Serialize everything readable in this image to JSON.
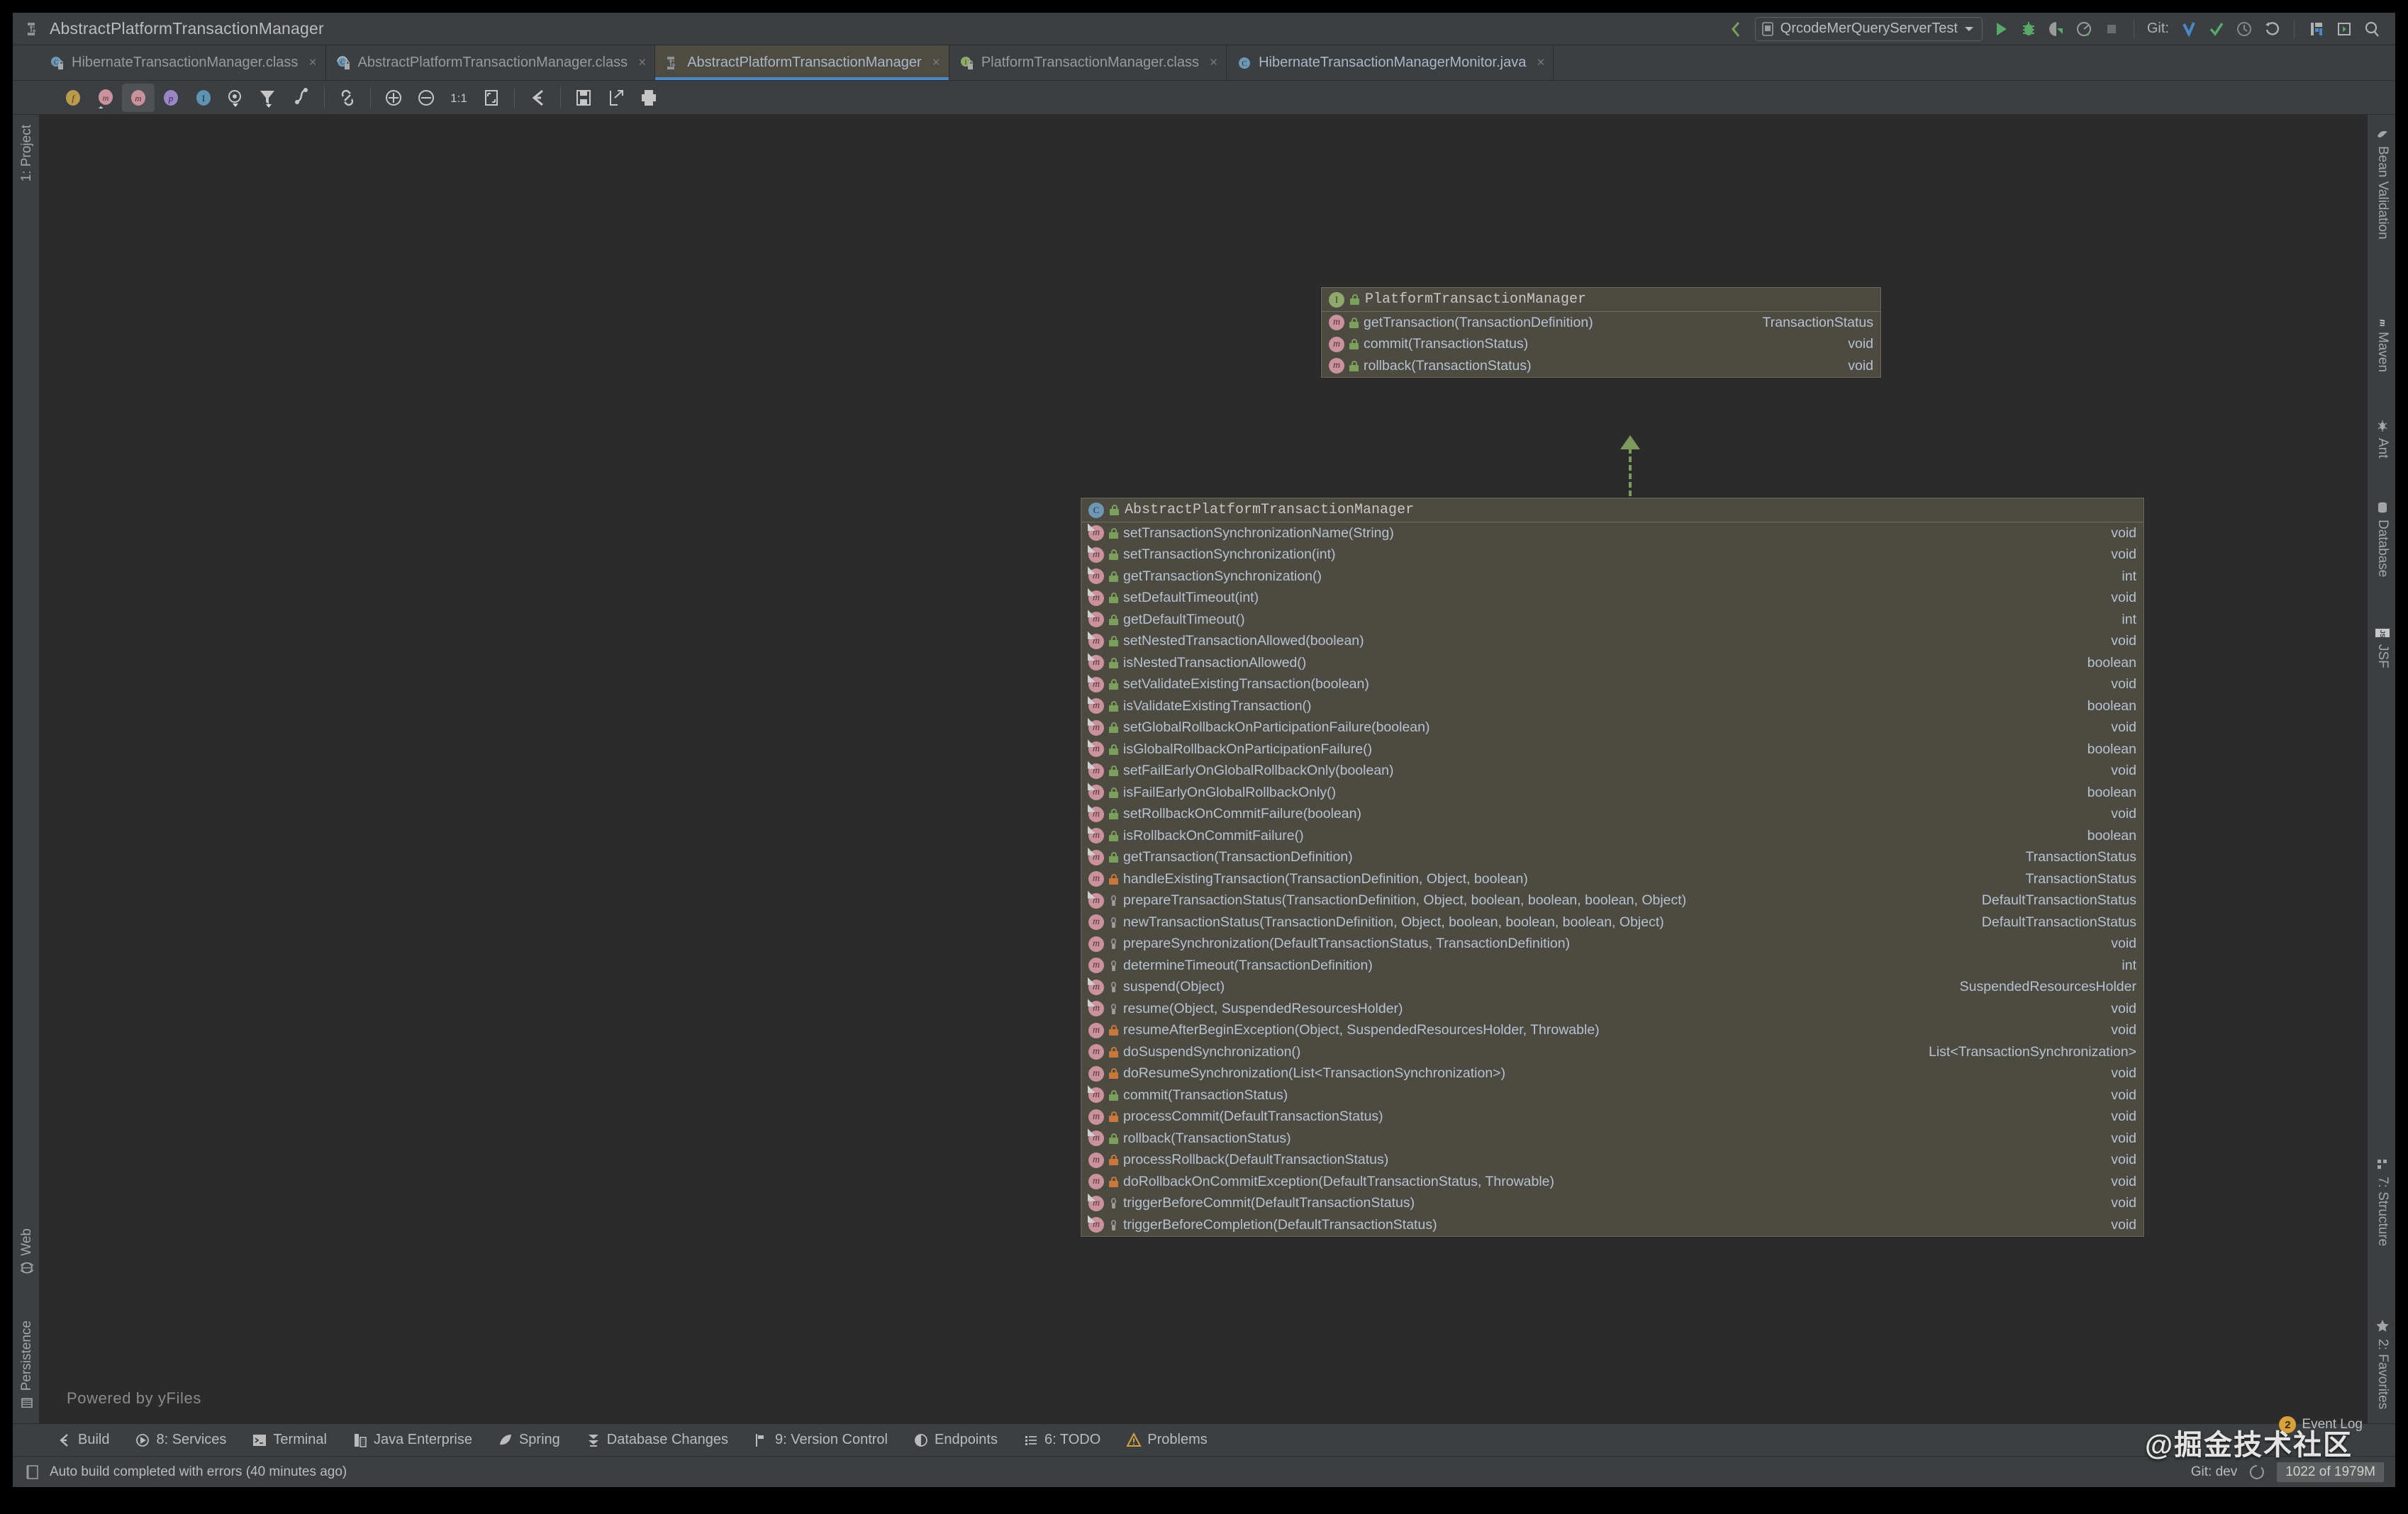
{
  "window": {
    "title": "AbstractPlatformTransactionManager",
    "title_icon": "uml-diagram-icon"
  },
  "toolbar_right": {
    "run_config": "QrcodeMerQueryServerTest",
    "git_label": "Git:",
    "icons": [
      "back-arrow-icon",
      "run-icon",
      "debug-icon",
      "run-coverage-icon",
      "profile-icon",
      "stop-icon",
      "git-update-icon",
      "git-commit-icon",
      "git-history-icon",
      "git-rollback-icon",
      "structure-icon",
      "preview-icon",
      "search-everywhere-icon"
    ]
  },
  "tabs": [
    {
      "label": "HibernateTransactionManager.class",
      "icon": "class-locked-icon",
      "active": false,
      "close": "×"
    },
    {
      "label": "AbstractPlatformTransactionManager.class",
      "icon": "abstract-class-locked-icon",
      "active": false,
      "close": "×"
    },
    {
      "label": "AbstractPlatformTransactionManager",
      "icon": "uml-diagram-icon",
      "active": true,
      "close": "×"
    },
    {
      "label": "PlatformTransactionManager.class",
      "icon": "interface-locked-icon",
      "active": false,
      "close": "×"
    },
    {
      "label": "HibernateTransactionManagerMonitor.java",
      "icon": "java-class-icon",
      "active": false,
      "close": "×"
    }
  ],
  "diagram_toolbar": [
    {
      "name": "show-fields-toggle",
      "glyph": "f"
    },
    {
      "name": "show-constructors-toggle",
      "glyph": "m"
    },
    {
      "name": "show-methods-toggle",
      "glyph": "m",
      "selected": true
    },
    {
      "name": "show-properties-toggle",
      "glyph": "p"
    },
    {
      "name": "show-inner-classes-toggle",
      "glyph": "I"
    },
    {
      "name": "visibility-level-dropdown",
      "glyph": "O"
    },
    {
      "name": "filter-dropdown",
      "glyph": "filter"
    },
    {
      "name": "show-dependencies-icon",
      "glyph": "dep"
    },
    {
      "name": "show-edges-icon",
      "glyph": "link"
    },
    {
      "name": "zoom-in-icon",
      "glyph": "plus"
    },
    {
      "name": "zoom-out-icon",
      "glyph": "minus"
    },
    {
      "name": "actual-size-icon",
      "glyph": "1:1"
    },
    {
      "name": "fit-content-icon",
      "glyph": "fit"
    },
    {
      "name": "layout-icon",
      "glyph": "layout"
    },
    {
      "name": "save-icon",
      "glyph": "save"
    },
    {
      "name": "export-icon",
      "glyph": "export"
    },
    {
      "name": "print-icon",
      "glyph": "print"
    }
  ],
  "canvas": {
    "powered_by": "Powered by yFiles"
  },
  "left_stripe": {
    "top": [
      "1: Project"
    ],
    "bottom": [
      "Web",
      "Persistence"
    ]
  },
  "right_stripe": {
    "top": [
      "Bean Validation",
      "Maven",
      "Ant",
      "Database",
      "JSF"
    ],
    "bottom": [
      "7: Structure",
      "2: Favorites"
    ]
  },
  "diagram": {
    "interface_box": {
      "name": "PlatformTransactionManager",
      "kind": "interface",
      "icon": "interface-icon",
      "members": [
        {
          "sig": "getTransaction(TransactionDefinition)",
          "ret": "TransactionStatus",
          "vis": "public",
          "overridden": false
        },
        {
          "sig": "commit(TransactionStatus)",
          "ret": "void",
          "vis": "public",
          "overridden": false
        },
        {
          "sig": "rollback(TransactionStatus)",
          "ret": "void",
          "vis": "public",
          "overridden": false
        }
      ]
    },
    "class_box": {
      "name": "AbstractPlatformTransactionManager",
      "kind": "abstract-class",
      "icon": "abstract-class-icon",
      "members": [
        {
          "sig": "setTransactionSynchronizationName(String)",
          "ret": "void",
          "vis": "public",
          "overridden": true
        },
        {
          "sig": "setTransactionSynchronization(int)",
          "ret": "void",
          "vis": "public",
          "overridden": true
        },
        {
          "sig": "getTransactionSynchronization()",
          "ret": "int",
          "vis": "public",
          "overridden": true
        },
        {
          "sig": "setDefaultTimeout(int)",
          "ret": "void",
          "vis": "public",
          "overridden": true
        },
        {
          "sig": "getDefaultTimeout()",
          "ret": "int",
          "vis": "public",
          "overridden": true
        },
        {
          "sig": "setNestedTransactionAllowed(boolean)",
          "ret": "void",
          "vis": "public",
          "overridden": true
        },
        {
          "sig": "isNestedTransactionAllowed()",
          "ret": "boolean",
          "vis": "public",
          "overridden": true
        },
        {
          "sig": "setValidateExistingTransaction(boolean)",
          "ret": "void",
          "vis": "public",
          "overridden": true
        },
        {
          "sig": "isValidateExistingTransaction()",
          "ret": "boolean",
          "vis": "public",
          "overridden": true
        },
        {
          "sig": "setGlobalRollbackOnParticipationFailure(boolean)",
          "ret": "void",
          "vis": "public",
          "overridden": true
        },
        {
          "sig": "isGlobalRollbackOnParticipationFailure()",
          "ret": "boolean",
          "vis": "public",
          "overridden": true
        },
        {
          "sig": "setFailEarlyOnGlobalRollbackOnly(boolean)",
          "ret": "void",
          "vis": "public",
          "overridden": true
        },
        {
          "sig": "isFailEarlyOnGlobalRollbackOnly()",
          "ret": "boolean",
          "vis": "public",
          "overridden": true
        },
        {
          "sig": "setRollbackOnCommitFailure(boolean)",
          "ret": "void",
          "vis": "public",
          "overridden": true
        },
        {
          "sig": "isRollbackOnCommitFailure()",
          "ret": "boolean",
          "vis": "public",
          "overridden": true
        },
        {
          "sig": "getTransaction(TransactionDefinition)",
          "ret": "TransactionStatus",
          "vis": "public",
          "overridden": true
        },
        {
          "sig": "handleExistingTransaction(TransactionDefinition, Object, boolean)",
          "ret": "TransactionStatus",
          "vis": "protected",
          "overridden": false
        },
        {
          "sig": "prepareTransactionStatus(TransactionDefinition, Object, boolean, boolean, boolean, Object)",
          "ret": "DefaultTransactionStatus",
          "vis": "package",
          "overridden": true
        },
        {
          "sig": "newTransactionStatus(TransactionDefinition, Object, boolean, boolean, boolean, Object)",
          "ret": "DefaultTransactionStatus",
          "vis": "package",
          "overridden": false
        },
        {
          "sig": "prepareSynchronization(DefaultTransactionStatus, TransactionDefinition)",
          "ret": "void",
          "vis": "package",
          "overridden": false
        },
        {
          "sig": "determineTimeout(TransactionDefinition)",
          "ret": "int",
          "vis": "package",
          "overridden": false
        },
        {
          "sig": "suspend(Object)",
          "ret": "SuspendedResourcesHolder",
          "vis": "package",
          "overridden": true
        },
        {
          "sig": "resume(Object, SuspendedResourcesHolder)",
          "ret": "void",
          "vis": "package",
          "overridden": true
        },
        {
          "sig": "resumeAfterBeginException(Object, SuspendedResourcesHolder, Throwable)",
          "ret": "void",
          "vis": "protected",
          "overridden": false
        },
        {
          "sig": "doSuspendSynchronization()",
          "ret": "List<TransactionSynchronization>",
          "vis": "protected",
          "overridden": false
        },
        {
          "sig": "doResumeSynchronization(List<TransactionSynchronization>)",
          "ret": "void",
          "vis": "protected",
          "overridden": false
        },
        {
          "sig": "commit(TransactionStatus)",
          "ret": "void",
          "vis": "public",
          "overridden": true
        },
        {
          "sig": "processCommit(DefaultTransactionStatus)",
          "ret": "void",
          "vis": "protected",
          "overridden": false
        },
        {
          "sig": "rollback(TransactionStatus)",
          "ret": "void",
          "vis": "public",
          "overridden": true
        },
        {
          "sig": "processRollback(DefaultTransactionStatus)",
          "ret": "void",
          "vis": "protected",
          "overridden": false
        },
        {
          "sig": "doRollbackOnCommitException(DefaultTransactionStatus, Throwable)",
          "ret": "void",
          "vis": "protected",
          "overridden": false
        },
        {
          "sig": "triggerBeforeCommit(DefaultTransactionStatus)",
          "ret": "void",
          "vis": "package",
          "overridden": true
        },
        {
          "sig": "triggerBeforeCompletion(DefaultTransactionStatus)",
          "ret": "void",
          "vis": "package",
          "overridden": true
        }
      ]
    },
    "connector": {
      "type": "realization-arrow",
      "color": "#7b9a5c"
    }
  },
  "bottom_tool_windows": [
    {
      "label": "Build",
      "icon": "build-icon"
    },
    {
      "label": "8: Services",
      "icon": "services-icon"
    },
    {
      "label": "Terminal",
      "icon": "terminal-icon"
    },
    {
      "label": "Java Enterprise",
      "icon": "java-enterprise-icon"
    },
    {
      "label": "Spring",
      "icon": "spring-leaf-icon"
    },
    {
      "label": "Database Changes",
      "icon": "database-changes-icon"
    },
    {
      "label": "9: Version Control",
      "icon": "version-control-icon"
    },
    {
      "label": "Endpoints",
      "icon": "endpoints-icon"
    },
    {
      "label": "6: TODO",
      "icon": "todo-icon"
    },
    {
      "label": "Problems",
      "icon": "problems-warning-icon"
    }
  ],
  "status_bar": {
    "message": "Auto build completed with errors (40 minutes ago)",
    "git_branch": "Git: dev",
    "memory": "1022 of 1979M",
    "event_log": "Event Log",
    "event_log_count": "2"
  },
  "watermark": "@掘金技术社区",
  "colors": {
    "window_bg": "#3c3f41",
    "canvas_bg": "#2b2b2b",
    "uml_box_bg": "#4c4a41",
    "uml_box_border": "#6e6c60",
    "text": "#bbbbbb",
    "sig_text": "#b6c2cf",
    "accent_tab": "#4a88c7",
    "connector": "#7b9a5c",
    "lock_public": "#7ba05b",
    "lock_protected": "#c9783c",
    "method_icon": "#c9929c",
    "interface_icon": "#8fa86b",
    "class_icon": "#6e97b5"
  }
}
